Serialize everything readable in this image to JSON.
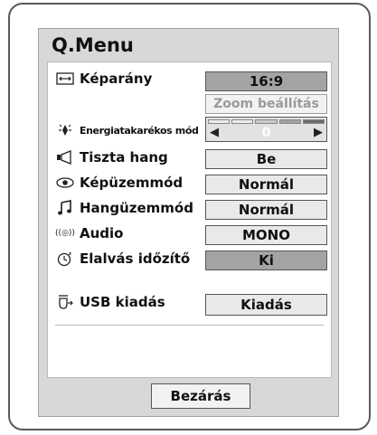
{
  "menu": {
    "title": "Q.Menu",
    "rows": [
      {
        "label": "Képarány",
        "icon": "aspect-ratio-icon",
        "value": "16:9",
        "selected": true
      },
      {
        "label": "",
        "icon": "",
        "value": "Zoom beállítás",
        "disabled": true
      },
      {
        "label": "Energiatakarékos mód",
        "icon": "energy-saving-icon",
        "value": "0",
        "control": "slider",
        "slider_level": 0
      },
      {
        "label": "Tiszta hang",
        "icon": "clear-voice-icon",
        "value": "Be"
      },
      {
        "label": "Képüzemmód",
        "icon": "eye-icon",
        "value": "Normál"
      },
      {
        "label": "Hangüzemmód",
        "icon": "music-note-icon",
        "value": "Normál"
      },
      {
        "label": "Audio",
        "icon": "audio-icon",
        "value": "MONO"
      },
      {
        "label": "Elalvás időzítő",
        "icon": "sleep-timer-icon",
        "value": "Ki",
        "selected": true
      },
      {
        "label": "USB kiadás",
        "icon": "usb-eject-icon",
        "value": "Kiadás"
      }
    ],
    "close_label": "Bezárás"
  },
  "icons": {
    "aspect_ratio": "⟷",
    "energy_saving": "☼",
    "clear_voice": "◁",
    "eye": "◉",
    "music_note": "♫",
    "audio": "((◎))",
    "sleep_timer": "◔",
    "usb_eject": "⏏",
    "arrow_left": "◀",
    "arrow_right": "▶"
  },
  "colors": {
    "panel_bg": "#d8d8d8",
    "selected_bg": "#a4a4a4",
    "value_bg": "#e9e9e9"
  }
}
